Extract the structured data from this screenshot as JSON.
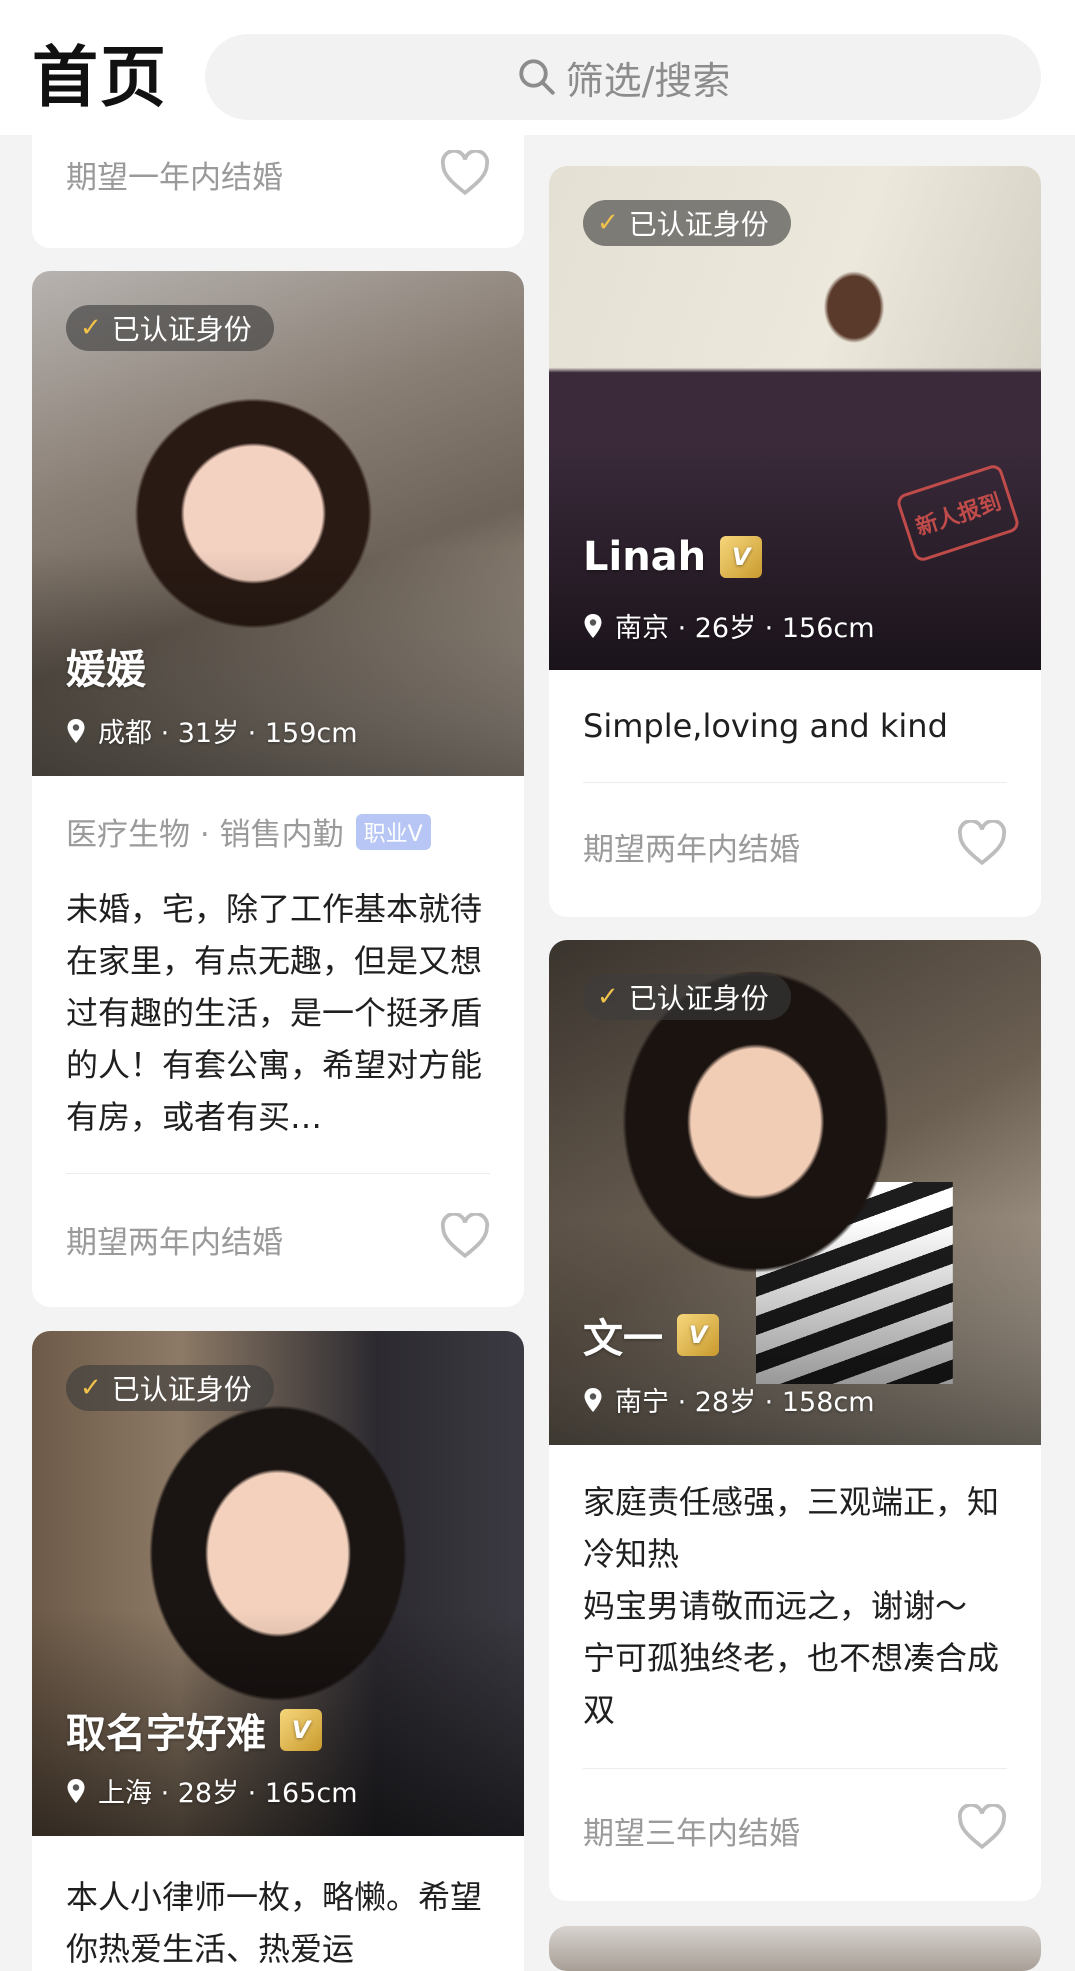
{
  "header": {
    "title": "首页",
    "search_placeholder": "筛选/搜索"
  },
  "cards": [
    {
      "id": "card-top-left-partial",
      "expect": "期望一年内结婚"
    },
    {
      "verified": "已认证身份",
      "name": "媛媛",
      "vip": false,
      "location": "成都 · 31岁 · 159cm",
      "job": "医疗生物 · 销售内勤",
      "job_badge": "职业V",
      "description": "未婚，宅，除了工作基本就待在家里，有点无趣，但是又想过有趣的生活，是一个挺矛盾的人！有套公寓，希望对方能有房，或者有买…",
      "expect": "期望两年内结婚"
    },
    {
      "verified": "已认证身份",
      "name": "取名字好难",
      "vip": true,
      "location": "上海 · 28岁 · 165cm",
      "description": "本人小律师一枚，略懒。希望你热爱生活、热爱运"
    },
    {
      "verified": "已认证身份",
      "name": "Linah",
      "vip": true,
      "stamp": "新人报到",
      "location": "南京 · 26岁 · 156cm",
      "description": "Simple,loving and kind",
      "expect": "期望两年内结婚"
    },
    {
      "verified": "已认证身份",
      "name": "文一",
      "vip": true,
      "location": "南宁 · 28岁 · 158cm",
      "description": "家庭责任感强，三观端正，知冷知热\n妈宝男请敬而远之，谢谢～\n宁可孤独终老，也不想凑合成双",
      "expect": "期望三年内结婚"
    }
  ],
  "icons": {
    "search": "search-icon",
    "verified": "check-icon",
    "location": "location-pin-icon",
    "like": "heart-icon",
    "vip": "vip-badge-icon"
  },
  "colors": {
    "accent_gold": "#f1c24b",
    "job_badge": "#b8c6f5",
    "stamp_red": "#d9534f"
  }
}
